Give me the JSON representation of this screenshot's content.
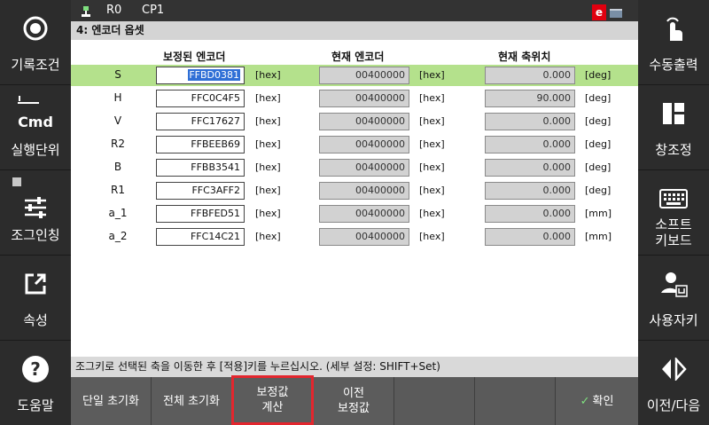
{
  "top_bar": {
    "robot": "R0",
    "program": "CP1",
    "error_badge": "e"
  },
  "title": "4: 엔코더 옵셋",
  "headers": {
    "corrected": "보정된 엔코더",
    "current_encoder": "현재 엔코더",
    "current_axis": "현재 축위치"
  },
  "rows": [
    {
      "axis": "S",
      "corrected": "FFBD0381",
      "corrected_unit": "[hex]",
      "encoder": "00400000",
      "encoder_unit": "[hex]",
      "position": "0.000",
      "position_unit": "[deg]"
    },
    {
      "axis": "H",
      "corrected": "FFC0C4F5",
      "corrected_unit": "[hex]",
      "encoder": "00400000",
      "encoder_unit": "[hex]",
      "position": "90.000",
      "position_unit": "[deg]"
    },
    {
      "axis": "V",
      "corrected": "FFC17627",
      "corrected_unit": "[hex]",
      "encoder": "00400000",
      "encoder_unit": "[hex]",
      "position": "0.000",
      "position_unit": "[deg]"
    },
    {
      "axis": "R2",
      "corrected": "FFBEEB69",
      "corrected_unit": "[hex]",
      "encoder": "00400000",
      "encoder_unit": "[hex]",
      "position": "0.000",
      "position_unit": "[deg]"
    },
    {
      "axis": "B",
      "corrected": "FFBB3541",
      "corrected_unit": "[hex]",
      "encoder": "00400000",
      "encoder_unit": "[hex]",
      "position": "0.000",
      "position_unit": "[deg]"
    },
    {
      "axis": "R1",
      "corrected": "FFC3AFF2",
      "corrected_unit": "[hex]",
      "encoder": "00400000",
      "encoder_unit": "[hex]",
      "position": "0.000",
      "position_unit": "[deg]"
    },
    {
      "axis": "a_1",
      "corrected": "FFBFED51",
      "corrected_unit": "[hex]",
      "encoder": "00400000",
      "encoder_unit": "[hex]",
      "position": "0.000",
      "position_unit": "[mm]"
    },
    {
      "axis": "a_2",
      "corrected": "FFC14C21",
      "corrected_unit": "[hex]",
      "encoder": "00400000",
      "encoder_unit": "[hex]",
      "position": "0.000",
      "position_unit": "[mm]"
    }
  ],
  "status_message": "조그키로 선택된 축을 이동한 후 [적용]키를 누르십시오. (세부 설정: SHIFT+Set)",
  "left_panel": {
    "record_condition": "기록조건",
    "cmd": "Cmd",
    "exec_unit": "실행단위",
    "jog_inching": "조그인칭",
    "property": "속성",
    "help": "도움말"
  },
  "right_panel": {
    "manual_output": "수동출력",
    "window_control": "창조정",
    "soft_keyboard_1": "소프트",
    "soft_keyboard_2": "키보드",
    "user_key": "사용자키",
    "prev_next": "이전/다음"
  },
  "bottom_buttons": {
    "single_reset": "단일 초기화",
    "all_reset": "전체 초기화",
    "calc_1": "보정값",
    "calc_2": "계산",
    "prev_1": "이전",
    "prev_2": "보정값",
    "confirm": "확인"
  },
  "icons": {
    "record": "record-circle-icon",
    "cmd": "cmd-step-icon",
    "jog": "sliders-icon",
    "property": "external-link-icon",
    "help": "question-icon",
    "manual": "touch-hand-icon",
    "window": "window-layout-icon",
    "keyboard": "keyboard-icon",
    "user": "user-key-icon",
    "prevnext": "prev-next-icon"
  },
  "colors": {
    "selected_row": "#b4e18c",
    "highlight": "#e3262e"
  }
}
